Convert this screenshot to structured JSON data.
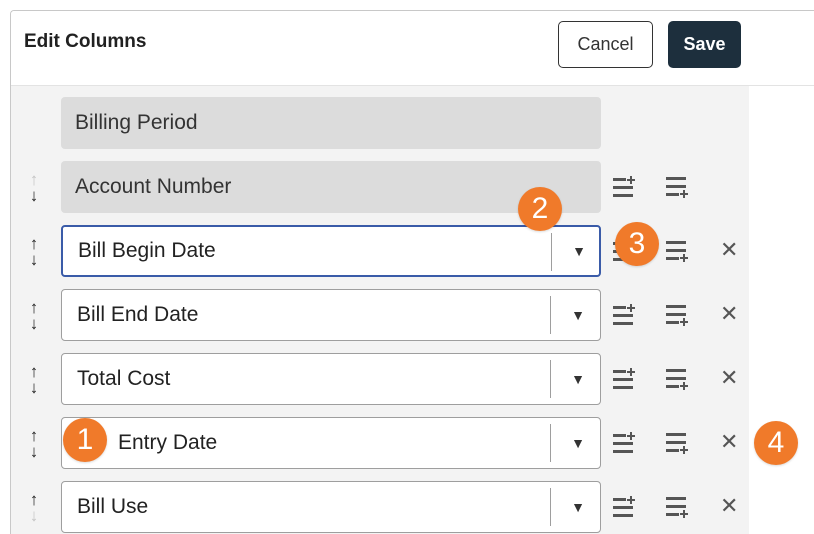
{
  "header": {
    "title": "Edit Columns",
    "cancel_label": "Cancel",
    "save_label": "Save"
  },
  "fixed_columns": [
    {
      "label": "Billing Period"
    },
    {
      "label": "Account Number"
    }
  ],
  "columns": [
    {
      "label": "Bill Begin Date",
      "focused": true
    },
    {
      "label": "Bill End Date",
      "focused": false
    },
    {
      "label": "Total Cost",
      "focused": false
    },
    {
      "label": "Entry Date",
      "focused": false
    },
    {
      "label": "Bill Use",
      "focused": false
    }
  ],
  "glyphs": {
    "arrow_up": "↑",
    "arrow_down": "↓",
    "caret": "▼",
    "close": "✕"
  },
  "callouts": [
    "1",
    "2",
    "3",
    "4"
  ],
  "colors": {
    "save_bg": "#1d2f3d",
    "callout": "#f07a2a",
    "focus_border": "#3a5ba8",
    "fixed_bg": "#dcdcdc"
  }
}
